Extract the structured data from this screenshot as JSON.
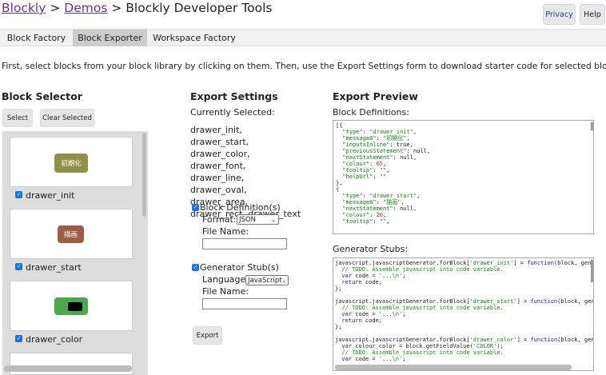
{
  "breadcrumb": {
    "link1": "Blockly",
    "sep1": ">",
    "link2": "Demos",
    "sep2": ">",
    "current": "Blockly Developer Tools"
  },
  "topbar": {
    "privacy": "Privacy",
    "help": "Help"
  },
  "tabs": [
    {
      "label": "Block Factory"
    },
    {
      "label": "Block Exporter"
    },
    {
      "label": "Workspace Factory"
    }
  ],
  "intro": "First, select blocks from your block library by clicking on them. Then, use the Export Settings form to download starter code for selected blocks.",
  "selector": {
    "title": "Block Selector",
    "select_btn": "Select",
    "clear_btn": "Clear Selected",
    "blocks": [
      {
        "label": "drawer_init",
        "block_text": "初期化",
        "color": "#8f9148"
      },
      {
        "label": "drawer_start",
        "block_text": "描画",
        "color": "#9c5c45"
      },
      {
        "label": "drawer_color",
        "block_text": "",
        "color": "#4ca84c"
      }
    ]
  },
  "settings": {
    "title": "Export Settings",
    "currently": "Currently Selected:",
    "selected_list": "drawer_init, drawer_start, drawer_color, drawer_font, drawer_line, drawer_oval, drawer_area, drawer_rect, drawer_text",
    "block_def_label": "Block Definition(s)",
    "format_label": "Format:",
    "format_value": "JSON",
    "file_name_label": "File Name:",
    "gen_label": "Generator Stub(s)",
    "language_label": "Language:",
    "language_value": "JavaScript",
    "file_name_label2": "File Name:",
    "export_btn": "Export"
  },
  "preview": {
    "title": "Export Preview",
    "defs_label": "Block Definitions:",
    "stubs_label": "Generator Stubs:"
  }
}
